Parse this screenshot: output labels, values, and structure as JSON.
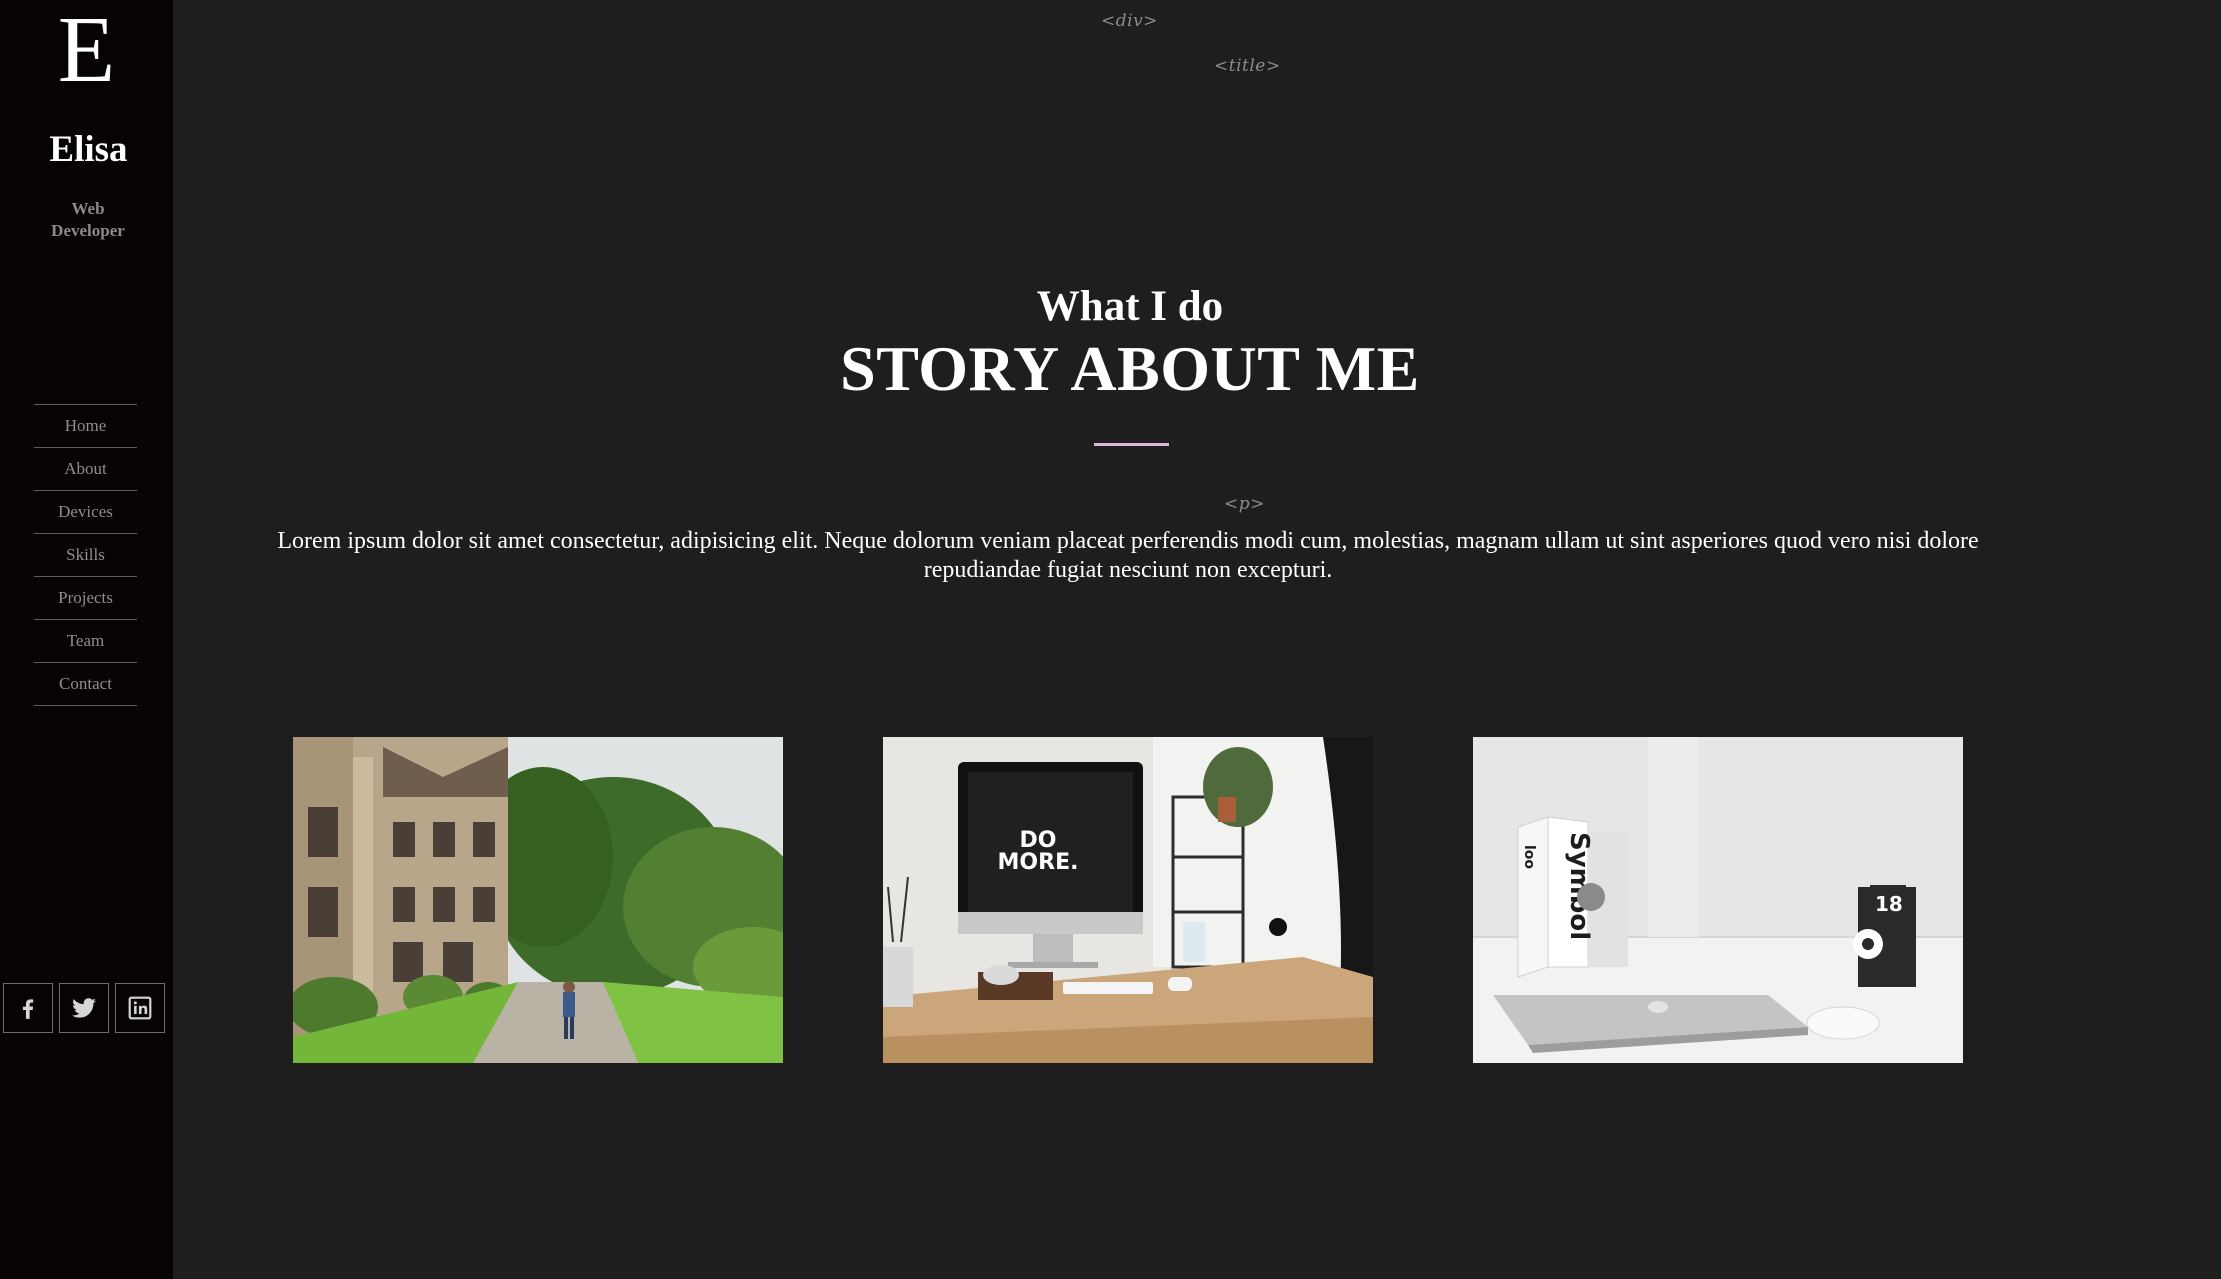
{
  "sidebar": {
    "logo_letter": "E",
    "name": "Elisa",
    "role": "Web Developer",
    "nav": [
      "Home",
      "About",
      "Devices",
      "Skills",
      "Projects",
      "Team",
      "Contact"
    ],
    "social": [
      "facebook-icon",
      "twitter-icon",
      "linkedin-icon"
    ]
  },
  "tags": {
    "div": "<div>",
    "title": "<title>",
    "p": "<p>"
  },
  "section": {
    "subtitle": "What I do",
    "title": "STORY ABOUT ME",
    "paragraph": "Lorem ipsum dolor sit amet consectetur, adipisicing elit. Neque dolorum veniam placeat perferendis modi cum, molestias, magnam ullam ut sint asperiores quod vero nisi dolore repudiandae fugiat nesciunt non excepturi.",
    "photo_3_text": {
      "book_title": "Symbol",
      "book_series": "loo",
      "calendar_day": "18"
    },
    "photo_2_text": "DO MORE."
  },
  "colors": {
    "background": "#1e1e1e",
    "sidebar": "#070203",
    "accent_divider": "#d8b8d4",
    "nav_text": "#8e8e8e"
  }
}
